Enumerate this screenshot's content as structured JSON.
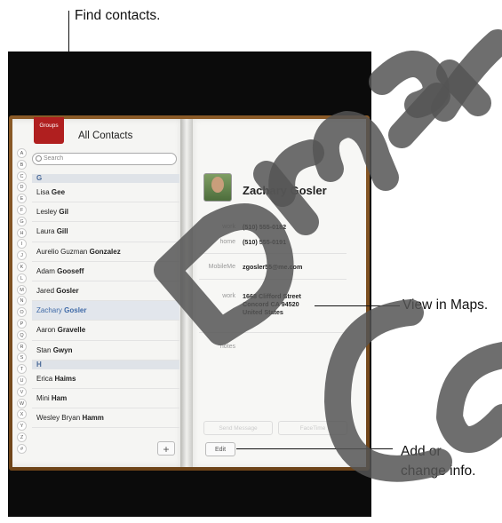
{
  "callouts": {
    "find": "Find contacts.",
    "maps": "View in Maps.",
    "add_line1": "Add or",
    "add_line2": "change info."
  },
  "watermark": "Draft Co",
  "app": {
    "groups_label": "Groups",
    "title": "All Contacts",
    "search_placeholder": "Search",
    "index": [
      "A",
      "B",
      "C",
      "D",
      "E",
      "F",
      "G",
      "H",
      "I",
      "J",
      "K",
      "L",
      "M",
      "N",
      "O",
      "P",
      "Q",
      "R",
      "S",
      "T",
      "U",
      "V",
      "W",
      "X",
      "Y",
      "Z",
      "#"
    ],
    "sections": [
      {
        "letter": "G",
        "contacts": [
          {
            "first": "Lisa",
            "last": "Gee"
          },
          {
            "first": "Lesley",
            "last": "Gil"
          },
          {
            "first": "Laura",
            "last": "Gill"
          },
          {
            "first": "Aurelio Guzman",
            "last": "Gonzalez"
          },
          {
            "first": "Adam",
            "last": "Gooseff"
          },
          {
            "first": "Jared",
            "last": "Gosler"
          },
          {
            "first": "Zachary",
            "last": "Gosler",
            "selected": true
          },
          {
            "first": "Aaron",
            "last": "Gravelle"
          },
          {
            "first": "Stan",
            "last": "Gwyn"
          }
        ]
      },
      {
        "letter": "H",
        "contacts": [
          {
            "first": "Erica",
            "last": "Haims"
          },
          {
            "first": "Mini",
            "last": "Ham"
          },
          {
            "first": "Wesley Bryan",
            "last": "Hamm"
          }
        ]
      }
    ],
    "add_label": "+"
  },
  "detail": {
    "name": "Zachary Gosler",
    "work_label": "work",
    "work_phone": "(510) 555-0182",
    "home_label": "home",
    "home_phone": "(510) 555-0191",
    "mobileme_label": "MobileMe",
    "email": "zgosler55@me.com",
    "address_label": "work",
    "address_line1": "1668 Clifford Street",
    "address_line2": "Concord CA 94520",
    "address_line3": "United States",
    "notes_label": "notes",
    "send_message": "Send Message",
    "facetime": "FaceTime",
    "edit_label": "Edit"
  }
}
